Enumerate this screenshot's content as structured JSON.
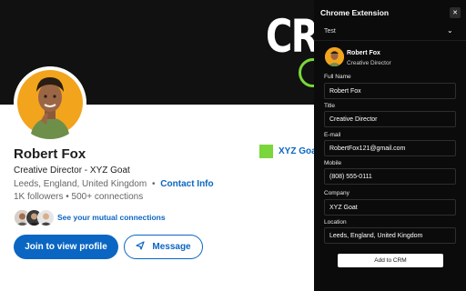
{
  "banner": {
    "word": "CRE"
  },
  "profile": {
    "name": "Robert Fox",
    "headline": "Creative Director - XYZ Goat",
    "location": "Leeds, England, United Kingdom",
    "separator": "•",
    "contact_label": "Contact Info",
    "followers": "1K followers • 500+ connections",
    "mutual_label": "See your mutual connections",
    "view_button": "Join to view profile",
    "message_button": "Message",
    "company": "XYZ Goat"
  },
  "extension": {
    "title": "Chrome Extension",
    "close_glyph": "✕",
    "selected_list": "Test",
    "chevron_glyph": "⌄",
    "profile_name": "Robert Fox",
    "profile_title": "Creative Director",
    "fields": {
      "full_name": {
        "label": "Full Name",
        "value": "Robert Fox"
      },
      "title": {
        "label": "Title",
        "value": "Creative Director"
      },
      "email": {
        "label": "E-mail",
        "value": "RobertFox121@gmail.com"
      },
      "mobile": {
        "label": "Mobile",
        "value": "(808) 555-0111"
      },
      "company": {
        "label": "Company",
        "value": "XYZ Goat"
      },
      "location": {
        "label": "Location",
        "value": "Leeds, England, United Kingdom"
      }
    },
    "add_button": "Add to CRM"
  },
  "colors": {
    "brand_blue": "#0a66c2",
    "company_green": "#7ad63a",
    "banner_bg": "#111111",
    "panel_bg": "#0b0b0b"
  },
  "icons": [
    "send-icon",
    "close-icon",
    "chevron-down-icon"
  ]
}
